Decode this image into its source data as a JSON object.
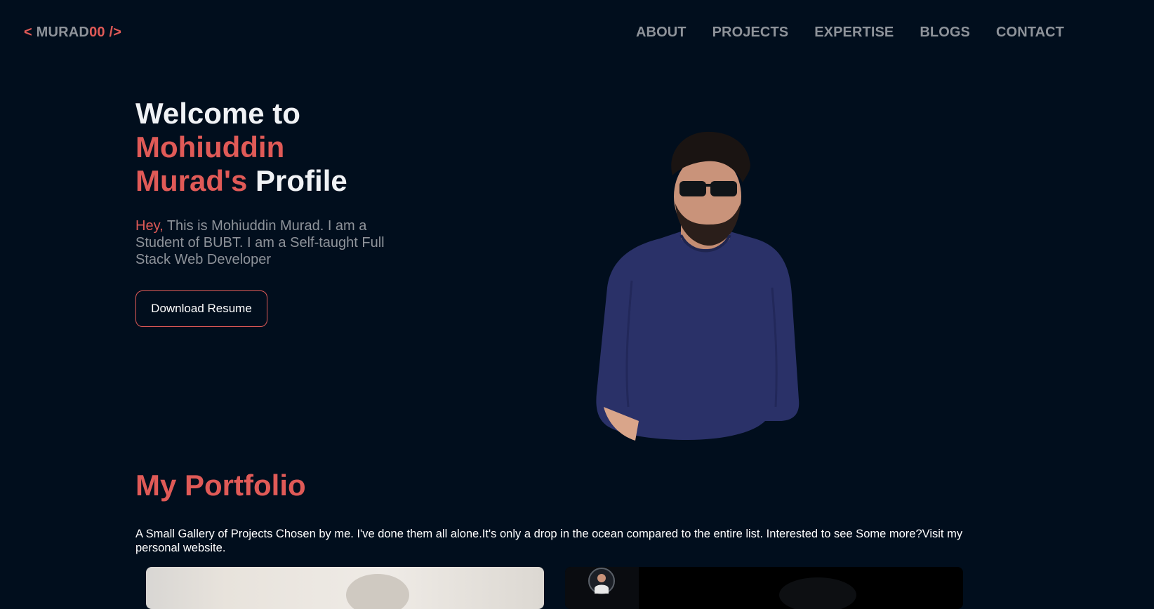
{
  "nav": {
    "logo_open": "< ",
    "logo_name": "MURAD",
    "logo_num": "00",
    "logo_close": " />",
    "items": [
      {
        "label": "ABOUT"
      },
      {
        "label": "PROJECTS"
      },
      {
        "label": "EXPERTISE"
      },
      {
        "label": "BLOGS"
      },
      {
        "label": "CONTACT"
      }
    ]
  },
  "hero": {
    "line1": "Welcome to",
    "line2": "Mohiuddin",
    "line3_red": "Murad's",
    "line3_rest": " Profile",
    "greeting": "Hey,",
    "description": " This is Mohiuddin Murad. I am a Student of BUBT. I am a Self-taught Full Stack Web Developer",
    "button_label": "Download Resume"
  },
  "portfolio": {
    "title": "My Portfolio",
    "description": "A Small Gallery of Projects Chosen by me. I've done them all alone.It's only a drop in the ocean compared to the entire list. Interested to see Some more?Visit my personal website."
  },
  "colors": {
    "background": "#010e1d",
    "accent": "#e05a57",
    "muted": "#8e939a"
  }
}
